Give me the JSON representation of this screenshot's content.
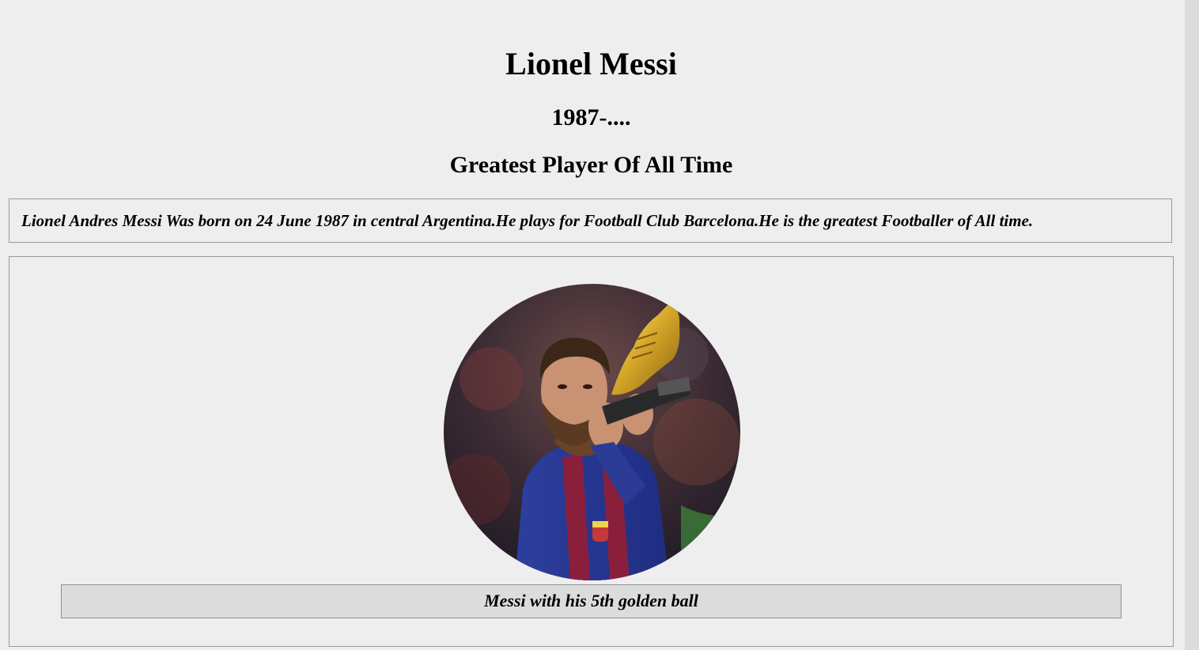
{
  "header": {
    "title": "Lionel Messi",
    "years": "1987-....",
    "subtitle": "Greatest Player Of All Time"
  },
  "bio": {
    "text": "Lionel Andres Messi Was born on 24 June 1987 in central Argentina.He plays for Football Club Barcelona.He is the greatest Footballer of All time."
  },
  "figure": {
    "image_subject": "messi-holding-golden-boot-photo",
    "caption": "Messi with his 5th golden ball"
  },
  "colors": {
    "page_background": "#eeeeee",
    "caption_background": "#dcdcdc",
    "border": "#9a9a9a"
  }
}
